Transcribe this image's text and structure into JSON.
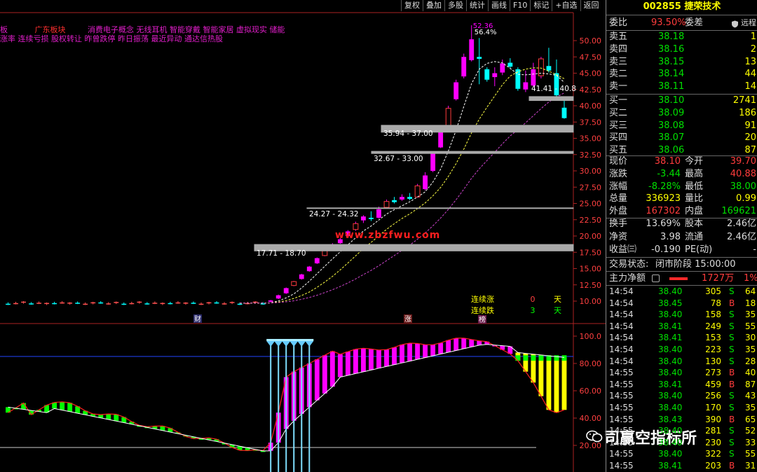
{
  "toolbar": {
    "items": [
      "复权",
      "叠加",
      "多股",
      "统计",
      "画线",
      "F10",
      "标记",
      "+自选",
      "返回"
    ]
  },
  "concepts": {
    "line1_prefix": "板",
    "line1_tag": "广东板块",
    "line1_items": "消费电子概念 无线耳机 智能穿戴 智能家居 虚拟现实 储能",
    "line2": "涨率 连续亏损 股权转让 昨曾跌停 昨日振荡 最近异动 通达信热股"
  },
  "chart_labels": {
    "high_label": "52.36",
    "pct_label": "56.4%",
    "zones": [
      "41.41 - 40.8",
      "35.94 - 37.00",
      "32.67 - 33.00",
      "24.27 - 24.32",
      "17.71 - 18.70"
    ],
    "markers": {
      "cai": "财",
      "zhang": "涨",
      "bang": "榜"
    }
  },
  "price_axis": [
    "50.00",
    "47.50",
    "45.00",
    "42.50",
    "40.00",
    "37.50",
    "35.00",
    "32.50",
    "30.00",
    "27.50",
    "25.00",
    "22.50",
    "20.00",
    "17.50",
    "15.00",
    "12.50",
    "10.00"
  ],
  "ind_axis": [
    "100.0",
    "80.00",
    "60.00",
    "40.00",
    "20.00"
  ],
  "streak": {
    "up_label": "连续涨",
    "up_value": "0",
    "up_unit": "天",
    "down_label": "连续跌",
    "down_value": "3",
    "down_unit": "天"
  },
  "watermark": {
    "site": "www.zbzfwu.com",
    "brand": "司赢空指标所"
  },
  "stock": {
    "code": "002855",
    "name": "捷荣技术"
  },
  "order_ratio": {
    "label1": "委比",
    "value1": "93.50%",
    "label2": "委差",
    "remote_label": "远程"
  },
  "asks": [
    {
      "label": "卖五",
      "price": "38.18",
      "vol": "1"
    },
    {
      "label": "卖四",
      "price": "38.16",
      "vol": "2"
    },
    {
      "label": "卖三",
      "price": "38.15",
      "vol": "13"
    },
    {
      "label": "卖二",
      "price": "38.14",
      "vol": "44"
    },
    {
      "label": "卖一",
      "price": "38.11",
      "vol": "14"
    }
  ],
  "bids": [
    {
      "label": "买一",
      "price": "38.10",
      "vol": "2741"
    },
    {
      "label": "买二",
      "price": "38.09",
      "vol": "186"
    },
    {
      "label": "买三",
      "price": "38.08",
      "vol": "91"
    },
    {
      "label": "买四",
      "price": "38.07",
      "vol": "20"
    },
    {
      "label": "买五",
      "price": "38.06",
      "vol": "87"
    }
  ],
  "quote": [
    {
      "l1": "现价",
      "v1": "38.10",
      "l2": "今开",
      "v2": "39.70",
      "c1": "r",
      "c2": "r"
    },
    {
      "l1": "涨跌",
      "v1": "-3.44",
      "l2": "最高",
      "v2": "40.88",
      "c1": "g",
      "c2": "r"
    },
    {
      "l1": "涨幅",
      "v1": "-8.28%",
      "l2": "最低",
      "v2": "38.00",
      "c1": "g",
      "c2": "g"
    },
    {
      "l1": "总量",
      "v1": "336923",
      "l2": "量比",
      "v2": "0.99",
      "c1": "y",
      "c2": "y"
    },
    {
      "l1": "外盘",
      "v1": "167302",
      "l2": "内盘",
      "v2": "169621",
      "c1": "r",
      "c2": "g"
    }
  ],
  "fund": [
    {
      "l1": "换手",
      "v1": "13.69%",
      "l2": "股本",
      "v2": "2.46亿"
    },
    {
      "l1": "净资",
      "v1": "3.98",
      "l2": "流通",
      "v2": "2.46亿"
    },
    {
      "l1": "收益㈢",
      "v1": "-0.190",
      "l2": "PE(动)",
      "v2": "-"
    }
  ],
  "trade_status": {
    "label": "交易状态:",
    "value": "闭市阶段 15:00:00"
  },
  "main_flow": {
    "label": "主力净额",
    "value": "1727万",
    "pct": "1%"
  },
  "ticks": [
    {
      "t": "14:54",
      "p": "38.40",
      "v": "305",
      "s": "S",
      "n": "64"
    },
    {
      "t": "14:54",
      "p": "38.45",
      "v": "78",
      "s": "B",
      "n": "18"
    },
    {
      "t": "14:54",
      "p": "38.40",
      "v": "158",
      "s": "S",
      "n": "35"
    },
    {
      "t": "14:54",
      "p": "38.41",
      "v": "249",
      "s": "S",
      "n": "55"
    },
    {
      "t": "14:54",
      "p": "38.41",
      "v": "153",
      "s": "S",
      "n": "30"
    },
    {
      "t": "14:54",
      "p": "38.40",
      "v": "223",
      "s": "S",
      "n": "35"
    },
    {
      "t": "14:54",
      "p": "38.40",
      "v": "130",
      "s": "S",
      "n": "28"
    },
    {
      "t": "14:55",
      "p": "38.40",
      "v": "273",
      "s": "B",
      "n": "40"
    },
    {
      "t": "14:55",
      "p": "38.41",
      "v": "459",
      "s": "B",
      "n": "87"
    },
    {
      "t": "14:55",
      "p": "38.40",
      "v": "256",
      "s": "S",
      "n": "43"
    },
    {
      "t": "14:55",
      "p": "38.40",
      "v": "170",
      "s": "S",
      "n": "35"
    },
    {
      "t": "14:55",
      "p": "38.43",
      "v": "390",
      "s": "B",
      "n": "65"
    },
    {
      "t": "14:55",
      "p": "38.40",
      "v": "281",
      "s": "S",
      "n": "52"
    },
    {
      "t": "14:55",
      "p": "38.40",
      "v": "230",
      "s": "S",
      "n": "33"
    },
    {
      "t": "14:55",
      "p": "38.40",
      "v": "322",
      "s": "S",
      "n": "55"
    },
    {
      "t": "14:55",
      "p": "38.41",
      "v": "203",
      "s": "B",
      "n": "31"
    }
  ],
  "colors": {
    "up": "#ff3c3c",
    "down": "#00ffff",
    "magenta": "#ff00ff",
    "green": "#00ff00",
    "yellow": "#ffff00"
  }
}
